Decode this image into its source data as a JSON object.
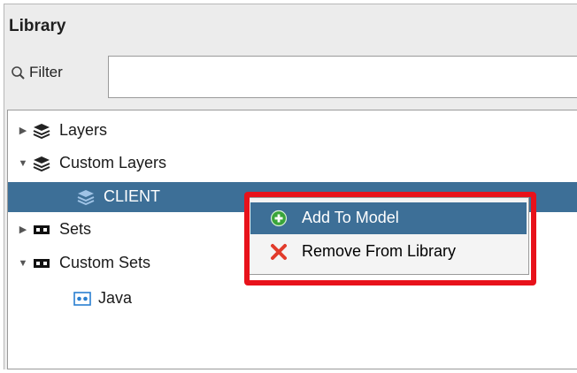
{
  "panel": {
    "title": "Library"
  },
  "filter": {
    "label": "Filter",
    "value": "",
    "placeholder": ""
  },
  "tree": {
    "items": [
      {
        "label": "Layers",
        "expanded": false,
        "icon": "layers-stack-icon"
      },
      {
        "label": "Custom Layers",
        "expanded": true,
        "icon": "layers-stack-icon"
      },
      {
        "label": "CLIENT",
        "selected": true,
        "icon": "layer-icon"
      },
      {
        "label": "Sets",
        "expanded": false,
        "icon": "set-icon"
      },
      {
        "label": "Custom Sets",
        "expanded": true,
        "icon": "set-icon"
      },
      {
        "label": "Java",
        "icon": "set-item-icon"
      }
    ]
  },
  "context_menu": {
    "items": [
      {
        "label": "Add To Model",
        "icon": "add-green-icon",
        "hover": true
      },
      {
        "label": "Remove From Library",
        "icon": "remove-red-x-icon"
      }
    ]
  },
  "colors": {
    "selection": "#3d6f97",
    "highlight_border": "#e8121b"
  }
}
